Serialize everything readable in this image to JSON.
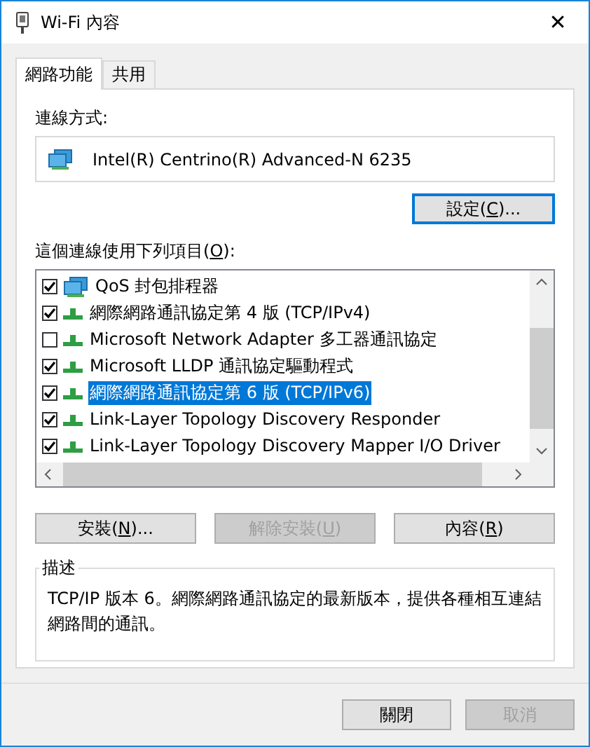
{
  "window": {
    "title": "Wi-Fi 內容",
    "close": "✕"
  },
  "tabs": [
    {
      "label": "網路功能",
      "selected": true
    },
    {
      "label": "共用",
      "selected": false
    }
  ],
  "connect_using": {
    "label": "連線方式:",
    "adapter": "Intel(R) Centrino(R) Advanced-N 6235",
    "configure": {
      "before": "設定(",
      "key": "C",
      "after": ")...",
      "disabled": false
    }
  },
  "items_label": {
    "before": "這個連線使用下列項目(",
    "key": "O",
    "after": "):"
  },
  "items": [
    {
      "name": "QoS 封包排程器",
      "kind": "service",
      "checked": true,
      "selected": false
    },
    {
      "name": "網際網路通訊協定第 4 版 (TCP/IPv4)",
      "kind": "protocol",
      "checked": true,
      "selected": false
    },
    {
      "name": "Microsoft Network Adapter 多工器通訊協定",
      "kind": "protocol",
      "checked": false,
      "selected": false
    },
    {
      "name": "Microsoft LLDP 通訊協定驅動程式",
      "kind": "protocol",
      "checked": true,
      "selected": false
    },
    {
      "name": "網際網路通訊協定第 6 版 (TCP/IPv6)",
      "kind": "protocol",
      "checked": true,
      "selected": true
    },
    {
      "name": "Link-Layer Topology Discovery Responder",
      "kind": "protocol",
      "checked": true,
      "selected": false
    },
    {
      "name": "Link-Layer Topology Discovery Mapper I/O Driver",
      "kind": "protocol",
      "checked": true,
      "selected": false
    }
  ],
  "item_buttons": [
    {
      "before": "安裝(",
      "key": "N",
      "after": ")...",
      "disabled": false
    },
    {
      "before": "解除安裝(",
      "key": "U",
      "after": ")",
      "disabled": true
    },
    {
      "before": "內容(",
      "key": "R",
      "after": ")",
      "disabled": false
    }
  ],
  "description": {
    "title": "描述",
    "text": "TCP/IP 版本 6。網際網路通訊協定的最新版本，提供各種相互連結網路間的通訊。"
  },
  "dialog_buttons": [
    {
      "label": "關閉",
      "disabled": false
    },
    {
      "label": "取消",
      "disabled": true
    }
  ]
}
